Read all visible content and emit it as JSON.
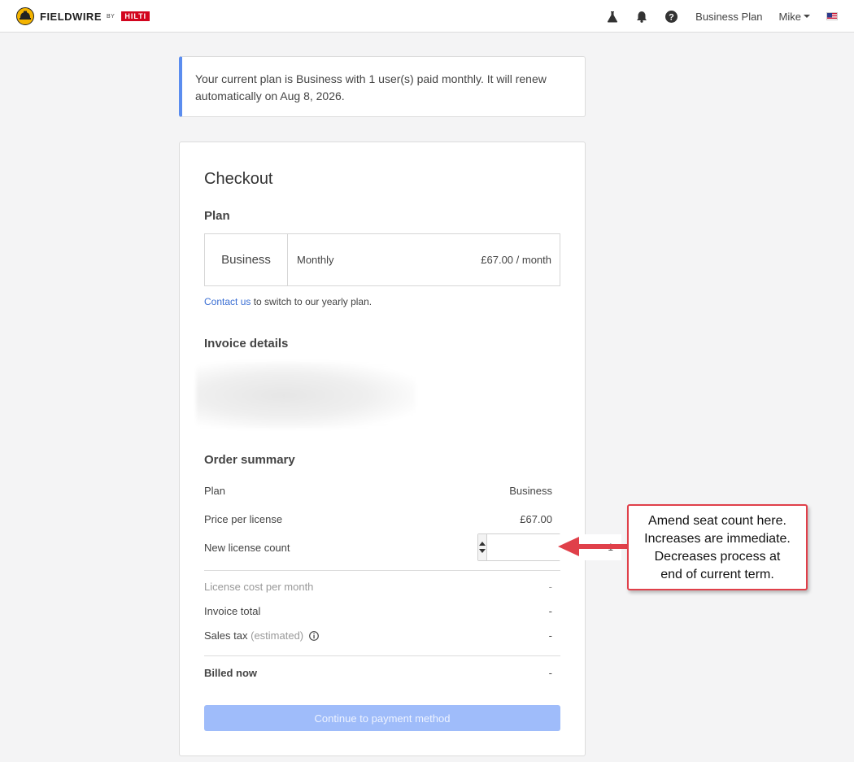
{
  "header": {
    "brand": "FIELDWIRE",
    "brand_by": "BY",
    "brand_partner": "HILTI",
    "nav_plan": "Business Plan",
    "user": "Mike",
    "icons": [
      "flask-icon",
      "bell-icon",
      "help-icon",
      "us-flag-icon"
    ]
  },
  "banner": {
    "text": "Your current plan is Business with 1 user(s) paid monthly. It will renew automatically on Aug 8, 2026."
  },
  "checkout": {
    "title": "Checkout",
    "plan_section": "Plan",
    "plan": {
      "name": "Business",
      "cycle": "Monthly",
      "price": "£67.00 / month"
    },
    "contact_link": "Contact us",
    "contact_rest": " to switch to our yearly plan.",
    "invoice_section": "Invoice details",
    "order_section": "Order summary",
    "summary": {
      "plan_label": "Plan",
      "plan_value": "Business",
      "price_label": "Price per license",
      "price_value": "£67.00",
      "count_label": "New license count",
      "count_value": "1",
      "license_cost_label": "License cost per month",
      "license_cost_value": "-",
      "invoice_total_label": "Invoice total",
      "invoice_total_value": "-",
      "sales_tax_label": "Sales tax",
      "sales_tax_note": "(estimated)",
      "sales_tax_value": "-",
      "billed_now_label": "Billed now",
      "billed_now_value": "-"
    },
    "cta": "Continue to payment method"
  },
  "annotation": {
    "lines": [
      "Amend seat count here.",
      "Increases are immediate.",
      "Decreases process at",
      "end of current term."
    ],
    "border_color": "#e0404a"
  },
  "colors": {
    "accent": "#5b8def",
    "link": "#3b6fd4",
    "cta_disabled": "#9fbcfa",
    "hilti_red": "#d2051e"
  }
}
